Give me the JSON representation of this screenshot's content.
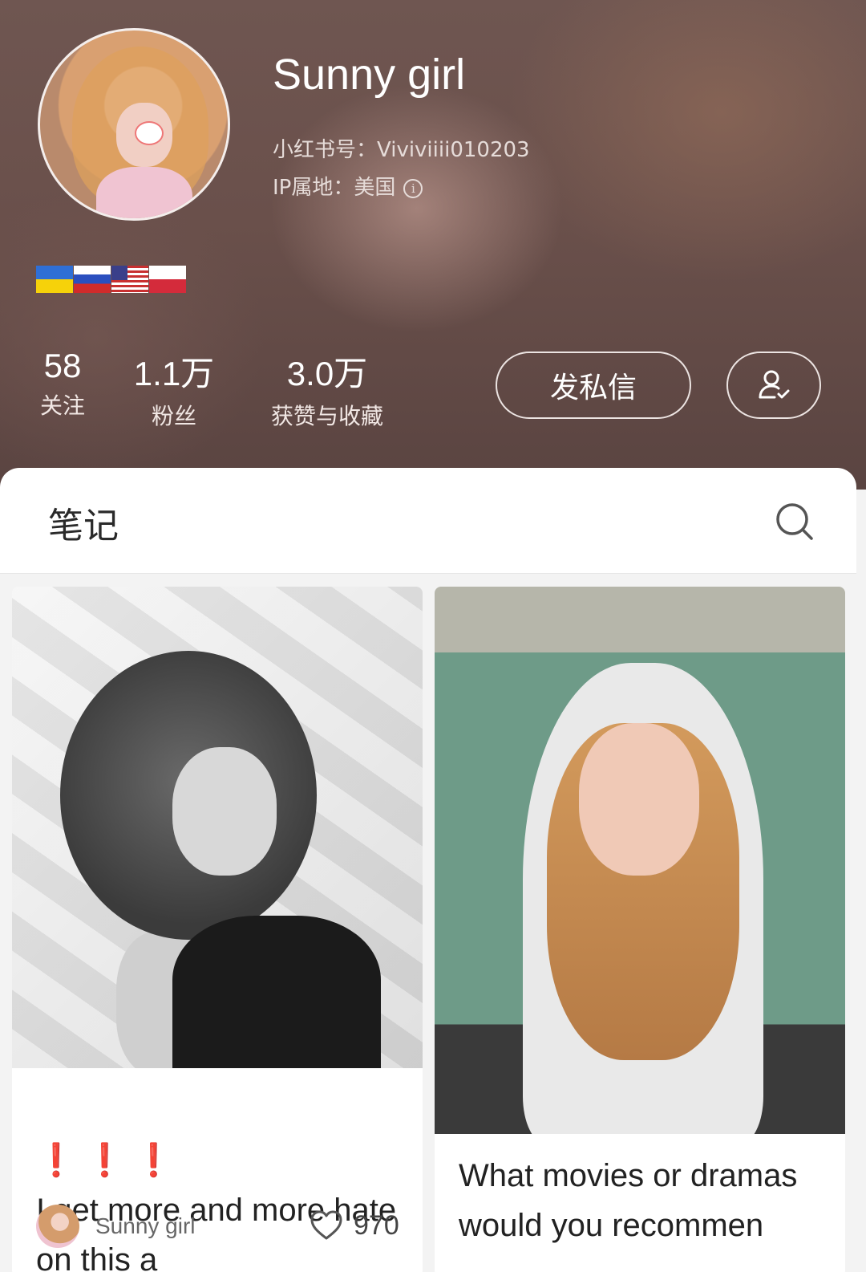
{
  "profile": {
    "name": "Sunny girl",
    "id_line": "小红书号：Viviviiii010203",
    "ip_line": "IP属地：美国",
    "flags": [
      "ukraine-flag",
      "russia-flag",
      "usa-flag",
      "poland-flag"
    ]
  },
  "stats": [
    {
      "value": "58",
      "label": "关注"
    },
    {
      "value": "1.1万",
      "label": "粉丝"
    },
    {
      "value": "3.0万",
      "label": "获赞与收藏"
    }
  ],
  "actions": {
    "message_label": "发私信",
    "follow_icon": "user-check-icon"
  },
  "notes_tab": {
    "title": "笔记",
    "search_icon": "search-icon"
  },
  "notes": [
    {
      "title_marks": "❗ ❗ ❗",
      "title_text": "I get more and more hate on this a",
      "author": "Sunny girl",
      "likes": "970"
    },
    {
      "title_text": "What movies or dramas would you recommen"
    }
  ],
  "colors": {
    "header_bg": "#6a504b",
    "accent_red": "#e23b3b",
    "panel_bg": "#ffffff"
  }
}
